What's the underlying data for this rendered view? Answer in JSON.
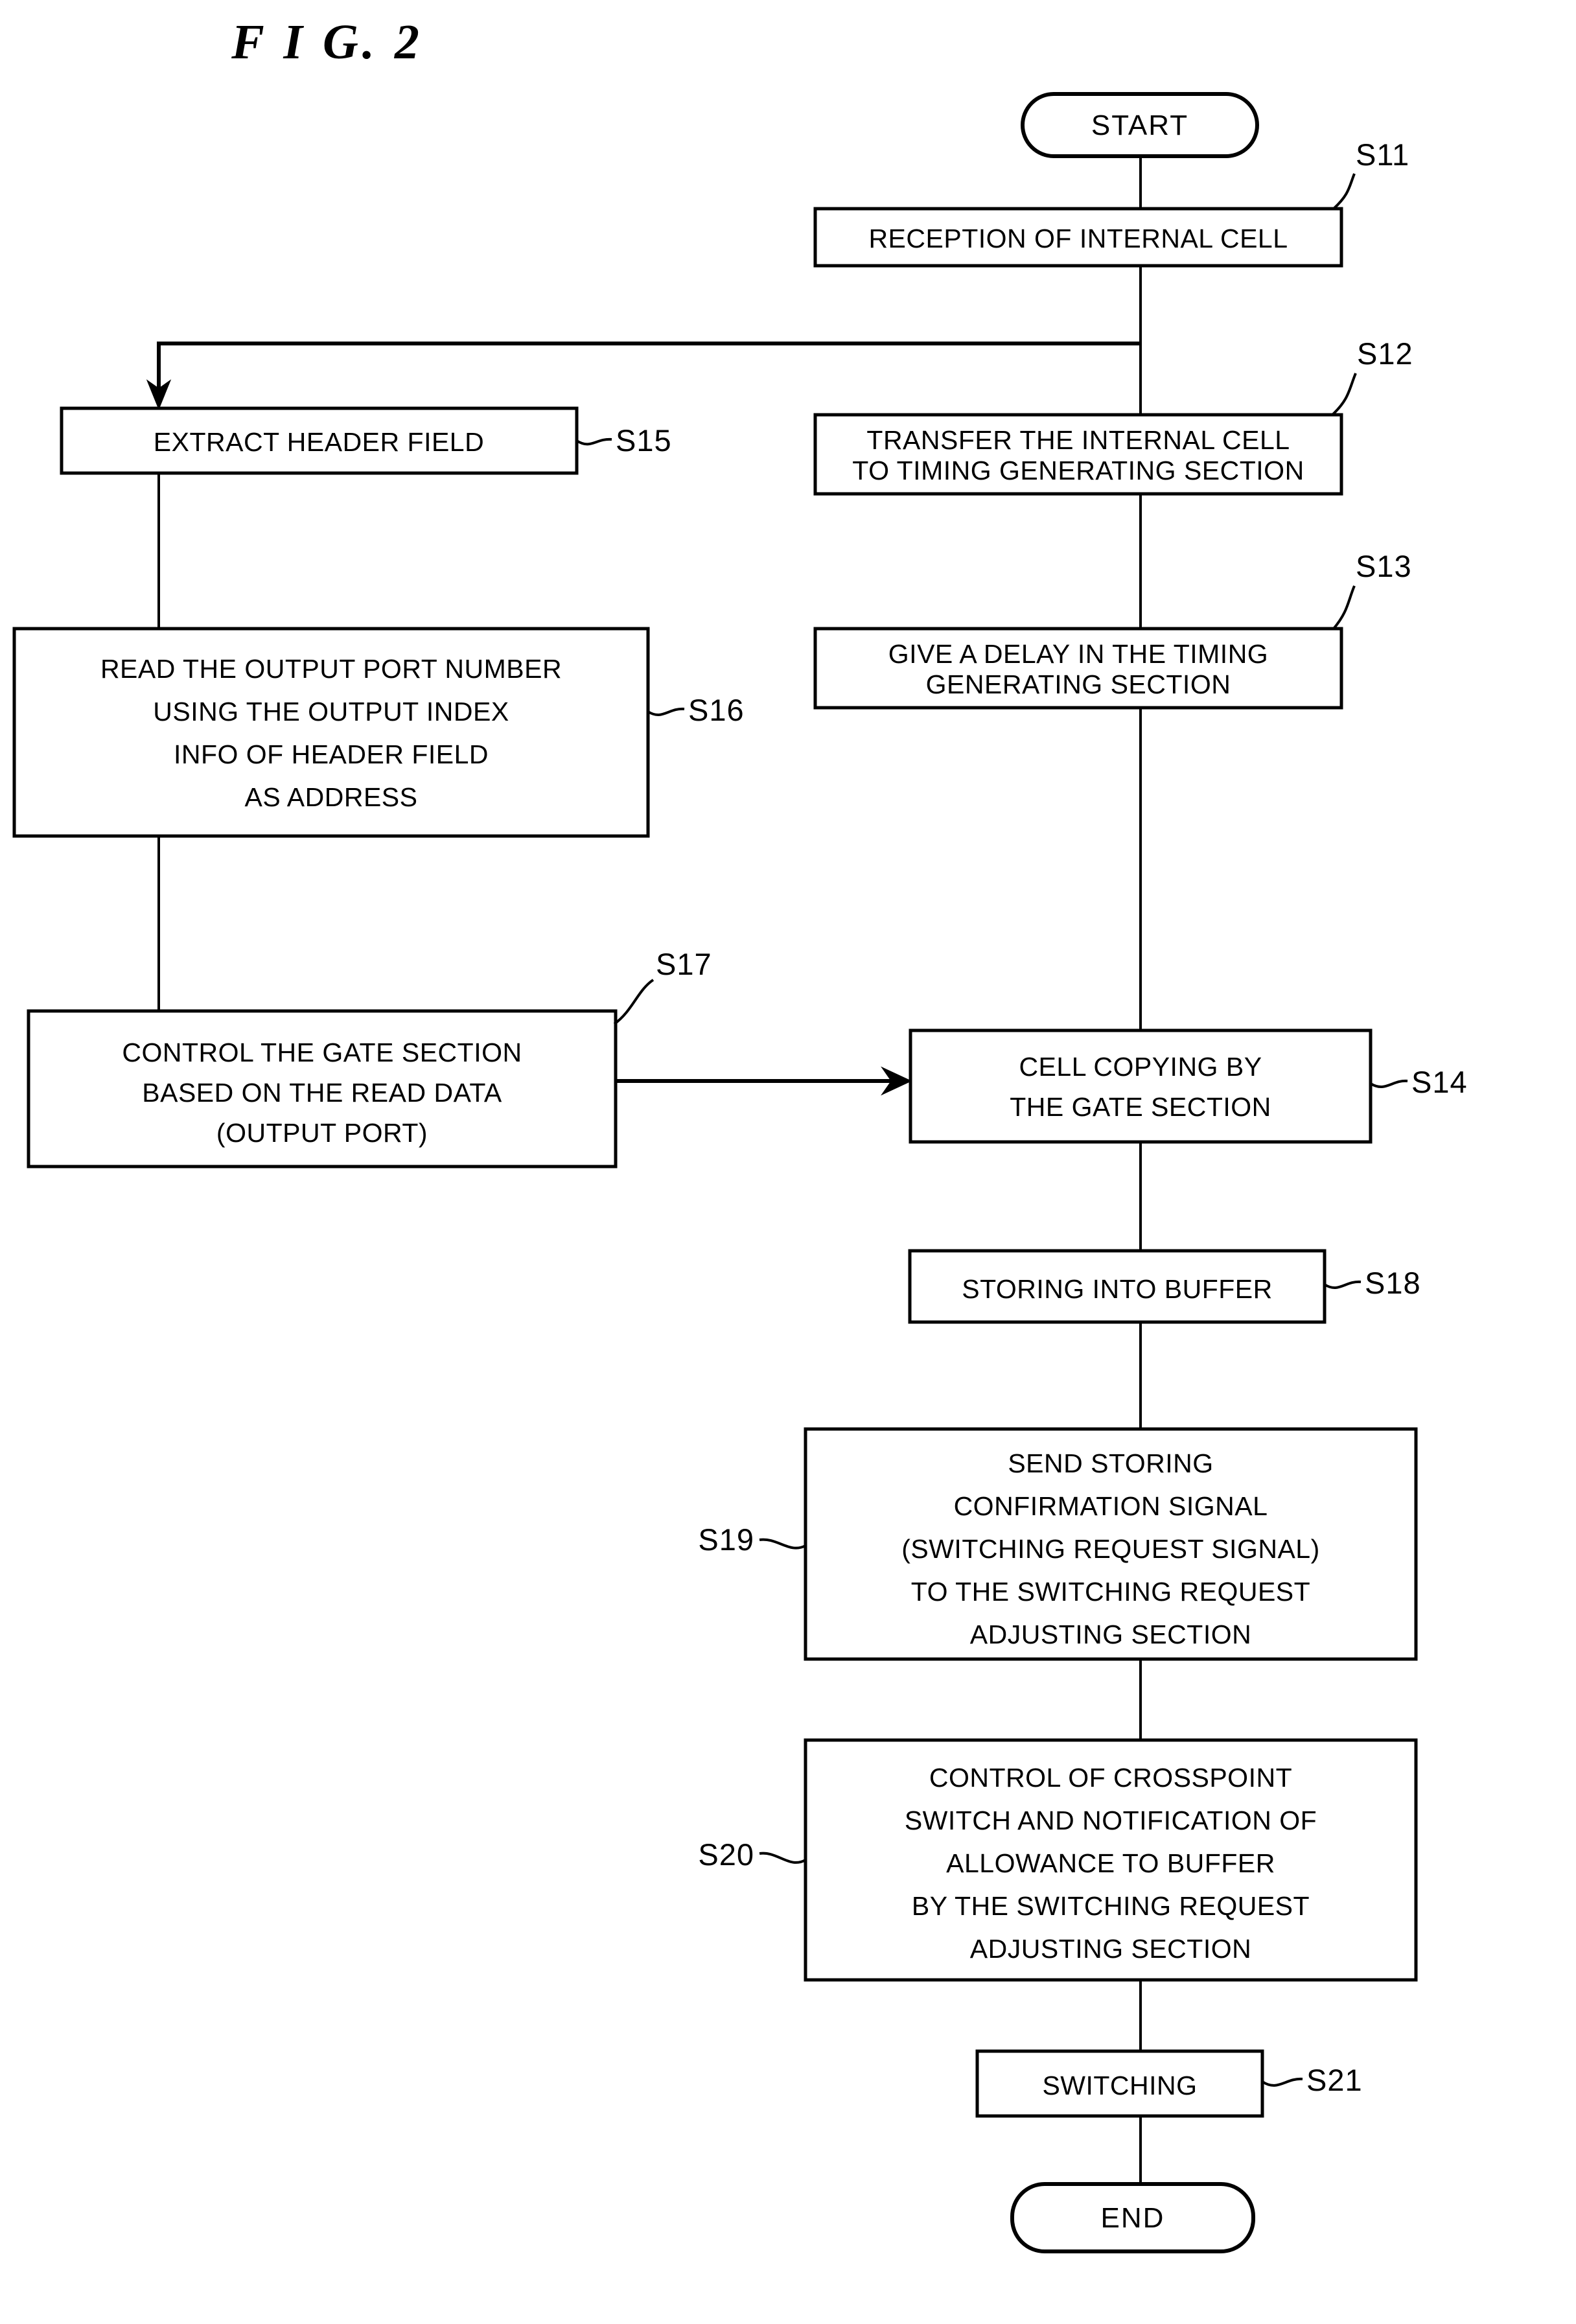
{
  "figure": {
    "title": "F I G. 2",
    "title_plain": "FIG.2",
    "type": "patent-flowchart"
  },
  "nodes": {
    "start": {
      "label": "START",
      "shape": "terminator"
    },
    "end": {
      "label": "END",
      "shape": "terminator"
    },
    "s11": {
      "tag": "S11",
      "lines": [
        "RECEPTION OF INTERNAL CELL"
      ]
    },
    "s12": {
      "tag": "S12",
      "lines": [
        "TRANSFER THE INTERNAL CELL",
        "TO TIMING GENERATING SECTION"
      ]
    },
    "s13": {
      "tag": "S13",
      "lines": [
        "GIVE A DELAY IN THE TIMING",
        "GENERATING SECTION"
      ]
    },
    "s14": {
      "tag": "S14",
      "lines": [
        "CELL COPYING BY",
        "THE GATE SECTION"
      ]
    },
    "s15": {
      "tag": "S15",
      "lines": [
        "EXTRACT HEADER FIELD"
      ]
    },
    "s16": {
      "tag": "S16",
      "lines": [
        "READ THE OUTPUT PORT NUMBER",
        "USING THE OUTPUT INDEX",
        "INFO OF HEADER FIELD",
        "AS ADDRESS"
      ]
    },
    "s17": {
      "tag": "S17",
      "lines": [
        "CONTROL THE GATE SECTION",
        "BASED ON THE READ DATA",
        "(OUTPUT PORT)"
      ]
    },
    "s18": {
      "tag": "S18",
      "lines": [
        "STORING INTO BUFFER"
      ]
    },
    "s19": {
      "tag": "S19",
      "lines": [
        "SEND STORING",
        "CONFIRMATION SIGNAL",
        "(SWITCHING REQUEST SIGNAL)",
        "TO THE SWITCHING REQUEST",
        "ADJUSTING SECTION"
      ]
    },
    "s20": {
      "tag": "S20",
      "lines": [
        "CONTROL OF CROSSPOINT",
        "SWITCH AND NOTIFICATION OF",
        "ALLOWANCE TO BUFFER",
        "BY THE SWITCHING REQUEST",
        "ADJUSTING SECTION"
      ]
    },
    "s21": {
      "tag": "S21",
      "lines": [
        "SWITCHING"
      ]
    }
  },
  "colors": {
    "ink": "#000000",
    "paper": "#ffffff"
  }
}
